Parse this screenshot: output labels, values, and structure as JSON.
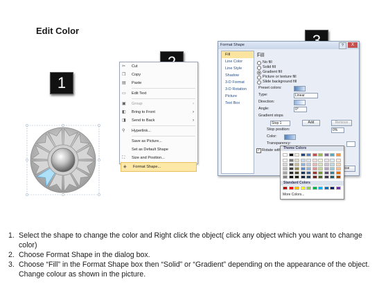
{
  "title": "Edit Color",
  "badges": [
    "1",
    "2",
    "3"
  ],
  "context_menu": {
    "items": [
      {
        "label": "Cut",
        "icon": "scissors-icon",
        "glyph": "✂",
        "disabled": false
      },
      {
        "label": "Copy",
        "icon": "copy-icon",
        "glyph": "❐",
        "disabled": false
      },
      {
        "label": "Paste",
        "icon": "paste-icon",
        "glyph": "▤",
        "disabled": false
      },
      {
        "label": "Edit Text",
        "icon": "edit-text-icon",
        "glyph": "▭",
        "disabled": false
      },
      {
        "label": "Group",
        "icon": "group-icon",
        "glyph": "▣",
        "disabled": true,
        "submenu": true
      },
      {
        "label": "Bring to Front",
        "icon": "bring-front-icon",
        "glyph": "◧",
        "disabled": false,
        "submenu": true
      },
      {
        "label": "Send to Back",
        "icon": "send-back-icon",
        "glyph": "◨",
        "disabled": false,
        "submenu": true
      },
      {
        "label": "Hyperlink...",
        "icon": "hyperlink-icon",
        "glyph": "⚲",
        "disabled": false
      },
      {
        "label": "Save as Picture...",
        "icon": "",
        "glyph": "",
        "disabled": false
      },
      {
        "label": "Set as Default Shape",
        "icon": "",
        "glyph": "",
        "disabled": false
      },
      {
        "label": "Size and Position...",
        "icon": "size-position-icon",
        "glyph": "⛶",
        "disabled": false
      },
      {
        "label": "Format Shape...",
        "icon": "format-shape-icon",
        "glyph": "◈",
        "disabled": false,
        "highlighted": true
      }
    ]
  },
  "dialog": {
    "title": "Format Shape",
    "help": "?",
    "close": "X",
    "nav": [
      "Fill",
      "Line Color",
      "Line Style",
      "Shadow",
      "3-D Format",
      "3-D Rotation",
      "Picture",
      "Text Box"
    ],
    "nav_selected": 0,
    "pane_heading": "Fill",
    "fill_options": [
      "No fill",
      "Solid fill",
      "Gradient fill",
      "Picture or texture fill",
      "Slide background fill"
    ],
    "fill_selected": 2,
    "preset_colors_label": "Preset colors:",
    "type_label": "Type:",
    "type_value": "Linear",
    "direction_label": "Direction:",
    "angle_label": "Angle:",
    "angle_value": "0°",
    "gradient_stops_label": "Gradient stops",
    "stop_value": "Stop 1",
    "add_button": "Add",
    "remove_button": "Remove",
    "stop_position_label": "Stop position:",
    "stop_position_value": "0%",
    "color_label": "Color:",
    "transparency_label": "Transparency:",
    "rotate_label": "Rotate with shape",
    "close_button": "Close"
  },
  "palette": {
    "theme_heading": "Theme Colors",
    "standard_heading": "Standard Colors",
    "more": "More Colors...",
    "theme_top": [
      "#ffffff",
      "#000000",
      "#eeece1",
      "#1f497d",
      "#4f81bd",
      "#c0504d",
      "#9bbb59",
      "#8064a2",
      "#4bacc6",
      "#f79646"
    ],
    "theme_shades": [
      [
        "#f2f2f2",
        "#7f7f7f",
        "#ddd9c3",
        "#c6d9f0",
        "#dbe5f1",
        "#f2dcdb",
        "#ebf1dd",
        "#e5e0ec",
        "#dbeef3",
        "#fdeada"
      ],
      [
        "#d8d8d8",
        "#595959",
        "#c4bd97",
        "#8db3e2",
        "#b8cce4",
        "#e5b9b7",
        "#d7e3bc",
        "#ccc1d9",
        "#b7dde8",
        "#fbd5b5"
      ],
      [
        "#bfbfbf",
        "#3f3f3f",
        "#938953",
        "#548dd4",
        "#95b3d7",
        "#d99694",
        "#c3d69b",
        "#b2a2c7",
        "#92cddc",
        "#fac08f"
      ],
      [
        "#a5a5a5",
        "#262626",
        "#494429",
        "#17365d",
        "#366092",
        "#953734",
        "#76923c",
        "#5f497a",
        "#31859b",
        "#e36c09"
      ],
      [
        "#7f7f7f",
        "#0c0c0c",
        "#1d1b10",
        "#0f243e",
        "#244061",
        "#632423",
        "#4f6128",
        "#3f3151",
        "#205867",
        "#974806"
      ]
    ],
    "standard": [
      "#c00000",
      "#ff0000",
      "#ffc000",
      "#ffff00",
      "#92d050",
      "#00b050",
      "#00b0f0",
      "#0070c0",
      "#002060",
      "#7030a0"
    ]
  },
  "instructions": [
    {
      "num": "1.",
      "text": "Select the shape to change the color and Right click the object( click any object which you want to change color)"
    },
    {
      "num": "2.",
      "text": "Choose Format Shape in the dialog box."
    },
    {
      "num": "3.",
      "text": "Choose “Fill” in the Format Shape box then “Solid” or “Gradient” depending on the appearance of the object. Change colour as shown in the picture."
    }
  ],
  "colors": {
    "highlight_segment": "#aee0f8",
    "menu_highlight": "#fde8a8",
    "close_red": "#c75050"
  }
}
